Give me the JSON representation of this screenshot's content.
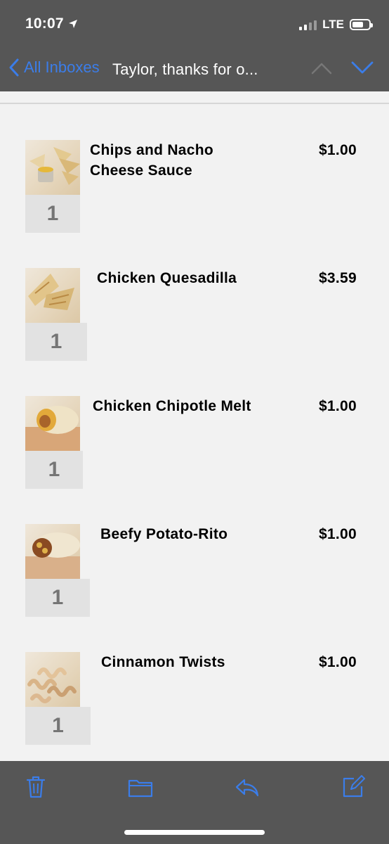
{
  "status_bar": {
    "time": "10:07",
    "network": "LTE"
  },
  "nav": {
    "back_label": "All Inboxes",
    "title": "Taylor, thanks for o..."
  },
  "items": [
    {
      "name": "Chips and Nacho Cheese Sauce",
      "price": "$1.00",
      "quantity": "1"
    },
    {
      "name": "Chicken Quesadilla",
      "price": "$3.59",
      "quantity": "1"
    },
    {
      "name": "Chicken Chipotle Melt",
      "price": "$1.00",
      "quantity": "1"
    },
    {
      "name": "Beefy Potato-Rito",
      "price": "$1.00",
      "quantity": "1"
    },
    {
      "name": "Cinnamon Twists",
      "price": "$1.00",
      "quantity": "1"
    }
  ],
  "toolbar": {
    "icons": [
      "trash-icon",
      "folder-icon",
      "reply-icon",
      "compose-icon"
    ]
  },
  "colors": {
    "accent": "#3b7de9",
    "header_bg": "#565656",
    "content_bg": "#f2f2f2"
  }
}
